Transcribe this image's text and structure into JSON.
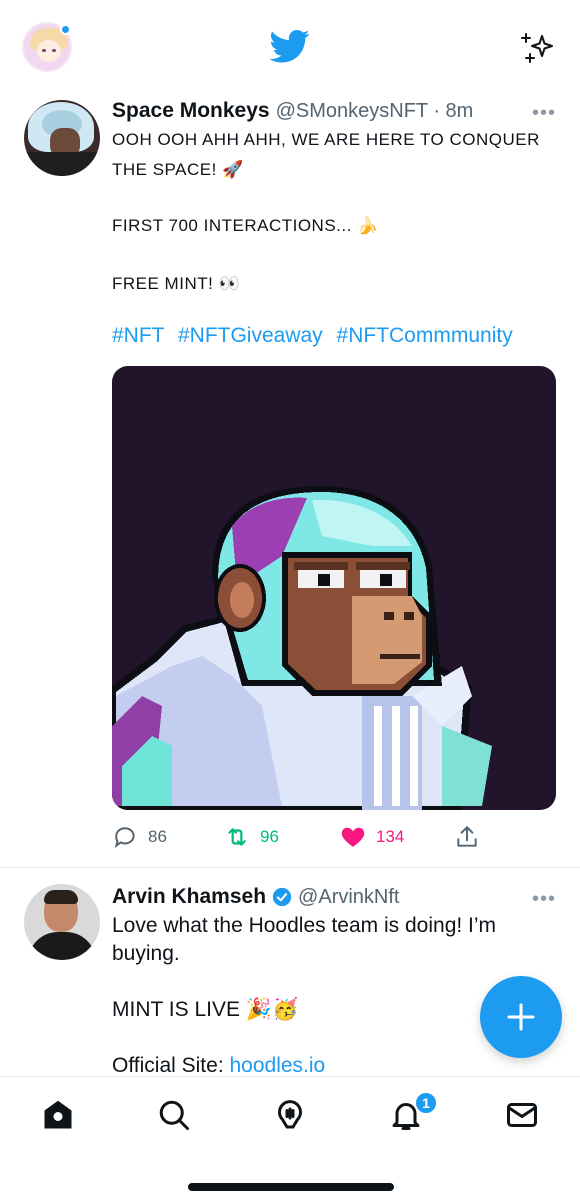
{
  "header": {
    "notification_dot_color": "#1d9bf0",
    "logo_icon": "twitter-bird-icon",
    "sparkle_icon": "sparkle-icon"
  },
  "tweet1": {
    "name": "Space Monkeys",
    "handle": "@SMonkeysNFT · 8m",
    "line1": "OOH OOH AHH AHH, WE ARE HERE TO CONQUER",
    "line2": "THE SPACE! 🚀",
    "line3": "FIRST 700 INTERACTIONS... 🍌",
    "line4": "FREE MINT! 👀",
    "tags": [
      "#NFT",
      "#NFTGiveaway",
      "#NFTCommmunity"
    ],
    "replies": "86",
    "retweets": "96",
    "likes": "134"
  },
  "tweet2": {
    "name": "Arvin Khamseh",
    "handle": "@ArvinkNft",
    "line1": "Love what the Hoodles team is doing! I’m",
    "line2": "buying.",
    "line3": "MINT IS LIVE 🎉🥳",
    "site_label": "Official Site: ",
    "site_link": "hoodles.io"
  },
  "nav": {
    "notification_count": "1"
  },
  "colors": {
    "accent": "#1d9bf0",
    "like": "#f91880",
    "retweet": "#00ba7c"
  }
}
